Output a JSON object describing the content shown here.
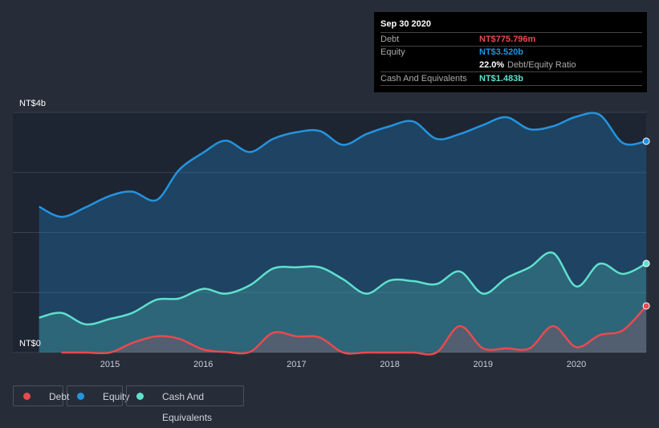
{
  "tooltip": {
    "date": "Sep 30 2020",
    "debt_label": "Debt",
    "debt_value": "NT$775.796m",
    "equity_label": "Equity",
    "equity_value": "NT$3.520b",
    "ratio_value": "22.0%",
    "ratio_label": "Debt/Equity Ratio",
    "cash_label": "Cash And Equivalents",
    "cash_value": "NT$1.483b"
  },
  "legend": [
    {
      "label": "Debt",
      "color": "#e84a4f"
    },
    {
      "label": "Equity",
      "color": "#2394df"
    },
    {
      "label": "Cash And Equivalents",
      "color": "#5ee0cd"
    }
  ],
  "chart_data": {
    "type": "area",
    "y_tick_labels": [
      "NT$4b",
      "NT$0"
    ],
    "ylim": [
      0,
      4
    ],
    "xlim": [
      2014.2,
      2020.75
    ],
    "x_tick_labels": [
      "2015",
      "2016",
      "2017",
      "2018",
      "2019",
      "2020"
    ],
    "grid": true,
    "legend_placement": "bottom-left",
    "x": [
      2014.24,
      2014.48,
      2014.74,
      2015.0,
      2015.24,
      2015.5,
      2015.74,
      2016.0,
      2016.24,
      2016.5,
      2016.75,
      2017.0,
      2017.25,
      2017.5,
      2017.75,
      2018.0,
      2018.25,
      2018.5,
      2018.75,
      2019.0,
      2019.25,
      2019.5,
      2019.75,
      2020.0,
      2020.25,
      2020.5,
      2020.75
    ],
    "series": [
      {
        "name": "Equity",
        "color": "#2394df",
        "values": [
          2.43,
          2.26,
          2.42,
          2.61,
          2.68,
          2.54,
          3.04,
          3.33,
          3.53,
          3.34,
          3.56,
          3.67,
          3.69,
          3.46,
          3.64,
          3.77,
          3.85,
          3.56,
          3.64,
          3.79,
          3.92,
          3.72,
          3.77,
          3.93,
          3.96,
          3.49,
          3.52
        ]
      },
      {
        "name": "Cash And Equivalents",
        "color": "#5ee0cd",
        "values": [
          0.58,
          0.66,
          0.47,
          0.56,
          0.66,
          0.88,
          0.9,
          1.06,
          0.98,
          1.12,
          1.4,
          1.42,
          1.42,
          1.22,
          0.98,
          1.2,
          1.19,
          1.14,
          1.35,
          0.98,
          1.24,
          1.42,
          1.66,
          1.1,
          1.48,
          1.31,
          1.483
        ]
      },
      {
        "name": "Debt",
        "color": "#e84a4f",
        "values": [
          null,
          0,
          0,
          0,
          0.16,
          0.27,
          0.23,
          0.05,
          0.01,
          0.01,
          0.33,
          0.27,
          0.25,
          0,
          0,
          0,
          0,
          0,
          0.44,
          0.07,
          0.07,
          0.07,
          0.44,
          0.09,
          0.29,
          0.37,
          0.776
        ]
      }
    ]
  }
}
